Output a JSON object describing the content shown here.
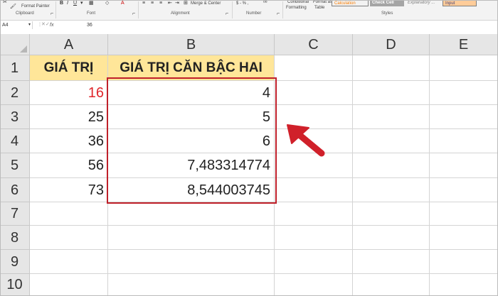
{
  "ribbon": {
    "format_painter": "Format Painter",
    "groups": {
      "clipboard": "Clipboard",
      "font": "Font",
      "alignment": "Alignment",
      "number": "Number",
      "styles": "Styles"
    },
    "merge_center": "Merge & Center",
    "number_format": "$ - % ,",
    "conditional_formatting": "Conditional",
    "conditional_formatting_2": "Formatting",
    "format_as_table": "Format as",
    "format_as_table_2": "Table",
    "styles_gallery": [
      "Calculation",
      "Check Cell",
      "Explanatory ...",
      "Input"
    ]
  },
  "formula_bar": {
    "name_box": "A4",
    "fx": "fx",
    "value": "36"
  },
  "columns": [
    "A",
    "B",
    "C",
    "D",
    "E"
  ],
  "rows": [
    "1",
    "2",
    "3",
    "4",
    "5",
    "6",
    "7",
    "8",
    "9",
    "10"
  ],
  "table": {
    "header_a": "GIÁ TRỊ",
    "header_b": "GIÁ TRỊ CĂN BẬC HAI",
    "values_a": [
      "16",
      "25",
      "36",
      "56",
      "73"
    ],
    "values_b": [
      "4",
      "5",
      "6",
      "7,483314774",
      "8,544003745"
    ]
  },
  "colors": {
    "header_fill": "#ffe699",
    "highlight_border": "#c0202a",
    "arrow": "#d0202a",
    "first_value": "#e0262b"
  },
  "annotation": {
    "arrow_icon": "red-arrow-icon"
  }
}
